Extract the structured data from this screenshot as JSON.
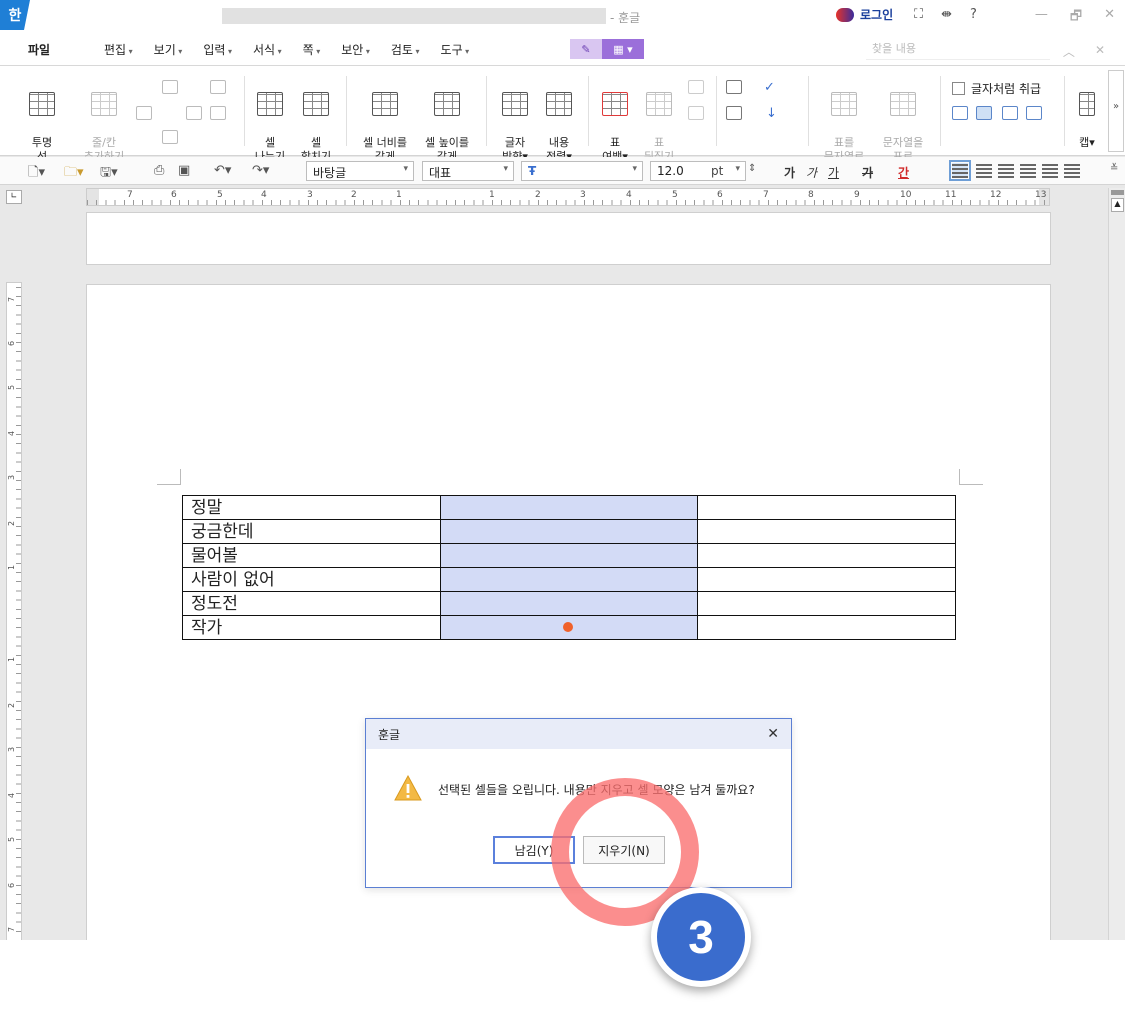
{
  "titlebar": {
    "app_icon": "한",
    "title_suffix": "- 훈글",
    "login": "로그인",
    "icons": [
      "fullscreen-icon",
      "pin-icon",
      "help-icon"
    ],
    "help": "?",
    "window_controls": [
      "—",
      "🗗",
      "✕"
    ]
  },
  "menubar": {
    "file": "파일",
    "items": [
      "편집",
      "보기",
      "입력",
      "서식",
      "쪽",
      "보안",
      "검토",
      "도구"
    ],
    "find_placeholder": "찾을 내용"
  },
  "ribbon": {
    "transparent_line": "투명\n선",
    "add_row_col": "줄/칸\n추가하기",
    "split_cell": "셀\n나누기",
    "merge_cell": "셀\n합치기",
    "equal_width": "셀 너비를\n같게",
    "equal_height": "셀 높이를\n같게",
    "text_direction": "글자\n방향▾",
    "content_align": "내용\n정렬▾",
    "table_margin": "표\n여백▾",
    "table_flip": "표\n뒤집기",
    "table_to_text": "표를\n문자열로",
    "text_to_table": "문자열을\n표로",
    "treat_as_char": "글자처럼 취급",
    "caption": "캡▾"
  },
  "format_toolbar": {
    "style": "바탕글",
    "font_kind": "대표",
    "font_name": "",
    "size": "12.0",
    "unit": "pt",
    "bold": "가",
    "italic": "가",
    "underline": "가",
    "strike": "가",
    "color": "간"
  },
  "ruler": {
    "numbers": [
      "7",
      "6",
      "5",
      "4",
      "3",
      "2",
      "1",
      "1",
      "2",
      "3",
      "4",
      "5",
      "6",
      "7",
      "8",
      "9",
      "10",
      "11",
      "12",
      "13"
    ],
    "v_numbers": [
      "7",
      "6",
      "5",
      "4",
      "3",
      "2",
      "1",
      "1",
      "2",
      "3",
      "4",
      "5",
      "6",
      "7"
    ]
  },
  "table": {
    "rows": [
      [
        "정말",
        "",
        ""
      ],
      [
        "궁금한데",
        "",
        ""
      ],
      [
        "물어볼",
        "",
        ""
      ],
      [
        "사람이 없어",
        "",
        ""
      ],
      [
        "정도전",
        "",
        ""
      ],
      [
        "작가",
        "",
        ""
      ]
    ],
    "selected_column_color": "#d3dbf6"
  },
  "dialog": {
    "title": "훈글",
    "close": "✕",
    "message": "선택된 셀들을 오립니다. 내용만 지우고 셀 모양은 남겨 둘까요?",
    "keep_button": "남김(Y)",
    "delete_button": "지우기(N)"
  },
  "annotation": {
    "step_number": "3",
    "ring_color": "#fa6e6e",
    "badge_color": "#3a6ccd"
  }
}
